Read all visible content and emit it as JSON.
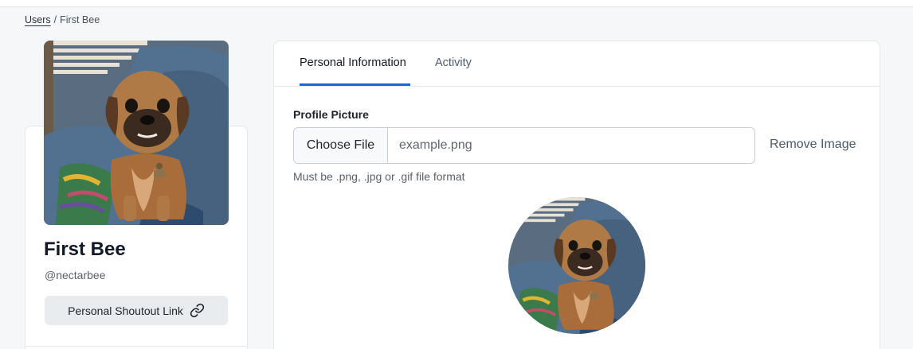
{
  "breadcrumb": {
    "parent": "Users",
    "separator": "/",
    "current": "First Bee"
  },
  "profile": {
    "display_name": "First Bee",
    "handle": "@nectarbee",
    "shoutout_label": "Personal Shoutout Link",
    "photo_alt": "dog photo"
  },
  "tabs": [
    {
      "label": "Personal Information",
      "active": true
    },
    {
      "label": "Activity",
      "active": false
    }
  ],
  "form": {
    "profile_picture_label": "Profile Picture",
    "choose_file_label": "Choose File",
    "file_name": "example.png",
    "remove_image_label": "Remove Image",
    "help_text": "Must be .png, .jpg or .gif file format"
  },
  "colors": {
    "accent": "#1a66d2",
    "page_bg": "#f6f7f9"
  },
  "icons": {
    "shoutout": "link-icon"
  }
}
